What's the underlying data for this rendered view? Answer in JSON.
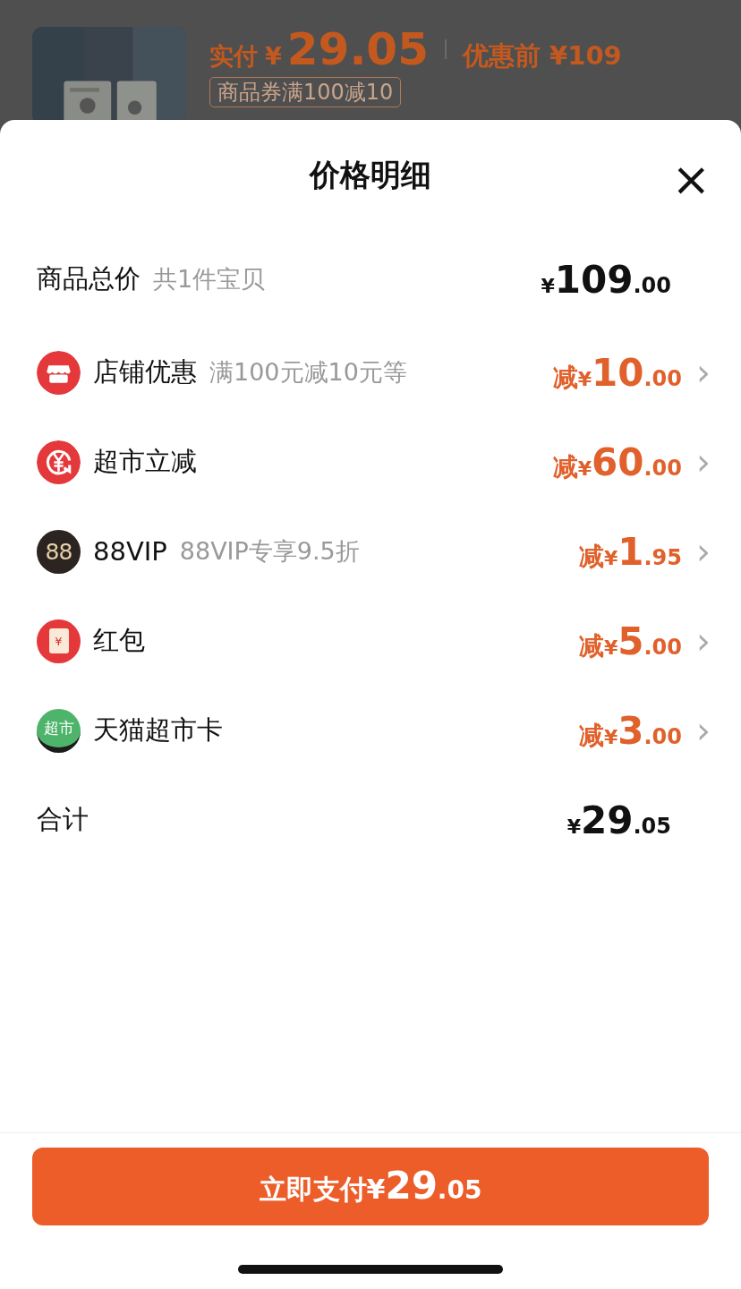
{
  "background": {
    "paid_label": "实付",
    "paid_currency": "¥",
    "paid_amount": "29.05",
    "original_price": "优惠前 ¥109",
    "coupon": "商品券满100减10"
  },
  "sheet": {
    "title": "价格明细",
    "close": "×"
  },
  "rows": [
    {
      "kind": "subtotal",
      "label": "商品总价",
      "note": "共1件宝贝",
      "prefix": "",
      "currency": "¥",
      "integer": "109",
      "fraction": ".00"
    },
    {
      "kind": "discount",
      "label": "店铺优惠",
      "note": "满100元减10元等",
      "prefix": "减",
      "currency": "¥",
      "integer": "10",
      "fraction": ".00",
      "chevron": "›"
    },
    {
      "kind": "discount",
      "label": "超市立减",
      "prefix": "减",
      "currency": "¥",
      "integer": "60",
      "fraction": ".00",
      "chevron": "›"
    },
    {
      "kind": "discount",
      "label": "88VIP",
      "note": "88VIP专享9.5折",
      "icon_text": "88",
      "prefix": "减",
      "currency": "¥",
      "integer": "1",
      "fraction": ".95",
      "chevron": "›"
    },
    {
      "kind": "discount",
      "label": "红包",
      "icon_text": "¥",
      "prefix": "减",
      "currency": "¥",
      "integer": "5",
      "fraction": ".00",
      "chevron": "›"
    },
    {
      "kind": "discount",
      "label": "天猫超市卡",
      "icon_text": "超市",
      "prefix": "减",
      "currency": "¥",
      "integer": "3",
      "fraction": ".00",
      "chevron": "›"
    },
    {
      "kind": "total",
      "label": "合计",
      "prefix": "",
      "currency": "¥",
      "integer": "29",
      "fraction": ".05"
    }
  ],
  "pay_button": {
    "label": "立即支付",
    "currency": "¥",
    "integer": "29",
    "fraction": ".05"
  }
}
